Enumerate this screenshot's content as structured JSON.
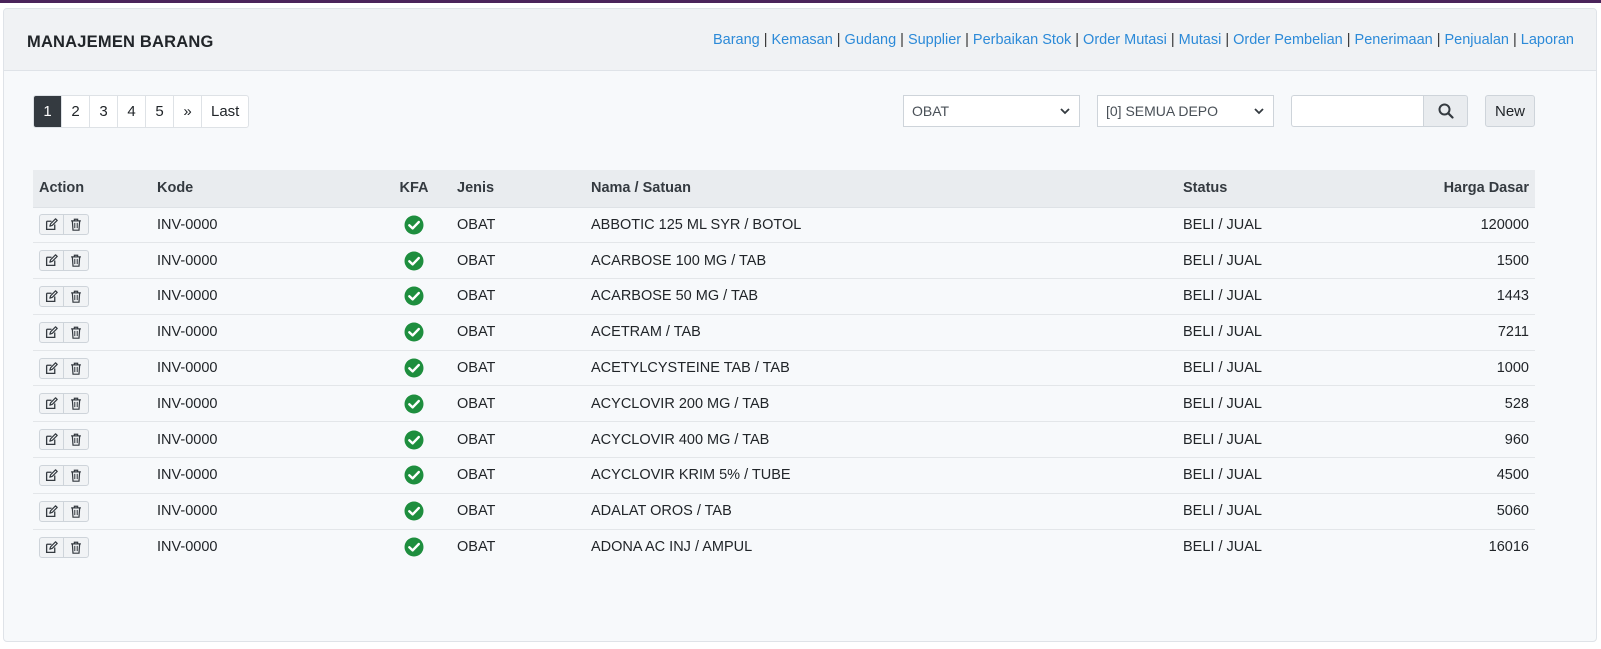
{
  "header": {
    "title": "MANAJEMEN BARANG",
    "nav": [
      "Barang",
      "Kemasan",
      "Gudang",
      "Supplier",
      "Perbaikan Stok",
      "Order Mutasi",
      "Mutasi",
      "Order Pembelian",
      "Penerimaan",
      "Penjualan",
      "Laporan"
    ],
    "nav_separator": "|"
  },
  "pagination": [
    "1",
    "2",
    "3",
    "4",
    "5",
    "»",
    "Last"
  ],
  "pagination_active": "1",
  "filters": {
    "type_select": "OBAT",
    "depo_select": "[0] SEMUA DEPO",
    "search_value": "",
    "new_label": "New"
  },
  "table": {
    "columns": [
      "Action",
      "Kode",
      "KFA",
      "Jenis",
      "Nama / Satuan",
      "Status",
      "Harga Dasar"
    ],
    "rows": [
      {
        "kode": "INV-0000",
        "kfa": "check-circle-icon",
        "jenis": "OBAT",
        "nama": "ABBOTIC 125 ML SYR / BOTOL",
        "status": "BELI / JUAL",
        "harga": "120000"
      },
      {
        "kode": "INV-0000",
        "kfa": "check-circle-icon",
        "jenis": "OBAT",
        "nama": "ACARBOSE 100 MG / TAB",
        "status": "BELI / JUAL",
        "harga": "1500"
      },
      {
        "kode": "INV-0000",
        "kfa": "check-circle-icon",
        "jenis": "OBAT",
        "nama": "ACARBOSE 50 MG / TAB",
        "status": "BELI / JUAL",
        "harga": "1443"
      },
      {
        "kode": "INV-0000",
        "kfa": "check-circle-icon",
        "jenis": "OBAT",
        "nama": "ACETRAM / TAB",
        "status": "BELI / JUAL",
        "harga": "7211"
      },
      {
        "kode": "INV-0000",
        "kfa": "check-circle-icon",
        "jenis": "OBAT",
        "nama": "ACETYLCYSTEINE TAB / TAB",
        "status": "BELI / JUAL",
        "harga": "1000"
      },
      {
        "kode": "INV-0000",
        "kfa": "check-circle-icon",
        "jenis": "OBAT",
        "nama": "ACYCLOVIR 200 MG / TAB",
        "status": "BELI / JUAL",
        "harga": "528"
      },
      {
        "kode": "INV-0000",
        "kfa": "check-circle-icon",
        "jenis": "OBAT",
        "nama": "ACYCLOVIR 400 MG / TAB",
        "status": "BELI / JUAL",
        "harga": "960"
      },
      {
        "kode": "INV-0000",
        "kfa": "check-circle-icon",
        "jenis": "OBAT",
        "nama": "ACYCLOVIR KRIM 5% / TUBE",
        "status": "BELI / JUAL",
        "harga": "4500"
      },
      {
        "kode": "INV-0000",
        "kfa": "check-circle-icon",
        "jenis": "OBAT",
        "nama": "ADALAT OROS / TAB",
        "status": "BELI / JUAL",
        "harga": "5060"
      },
      {
        "kode": "INV-0000",
        "kfa": "check-circle-icon",
        "jenis": "OBAT",
        "nama": "ADONA AC INJ / AMPUL",
        "status": "BELI / JUAL",
        "harga": "16016"
      }
    ]
  },
  "colors": {
    "top_bar": "#4a235a",
    "link": "#2c8ad8",
    "active_page": "#343a40",
    "check_green": "#1e8e3e"
  }
}
